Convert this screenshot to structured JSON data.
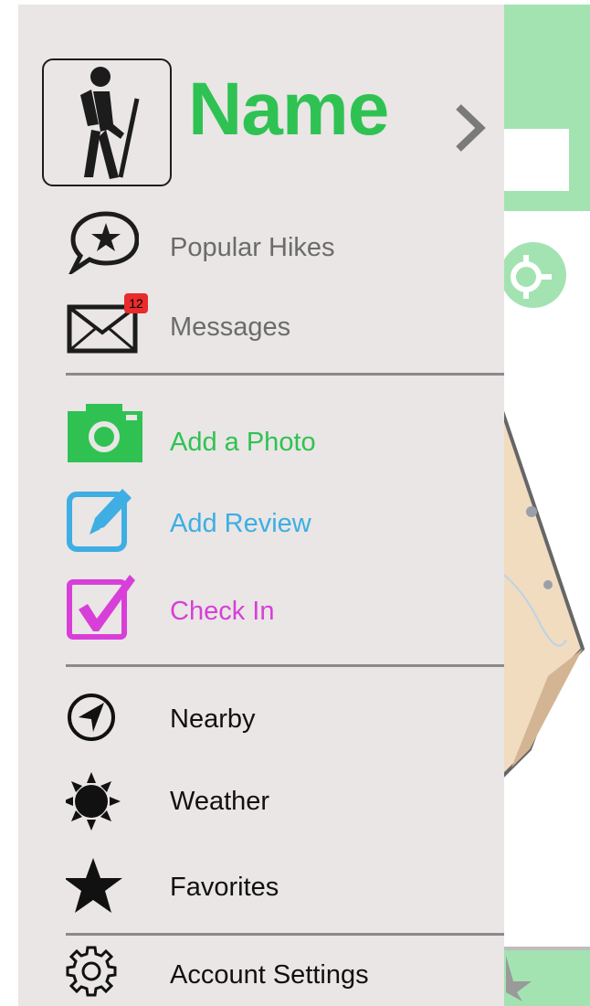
{
  "profile": {
    "name": "Name",
    "name_color": "#2fc253",
    "avatar_icon": "hiker-icon",
    "chevron_icon": "chevron-right-icon"
  },
  "menu": {
    "popular_hikes": {
      "label": "Popular Hikes",
      "icon": "speech-bubble-star-icon",
      "color": "#6b6b6b"
    },
    "messages": {
      "label": "Messages",
      "icon": "envelope-icon",
      "badge": "12",
      "badge_color": "#e82b2b",
      "color": "#6b6b6b"
    },
    "add_photo": {
      "label": "Add a Photo",
      "icon": "camera-icon",
      "color": "#2fc253"
    },
    "add_review": {
      "label": "Add Review",
      "icon": "edit-icon",
      "color": "#3eaee3"
    },
    "check_in": {
      "label": "Check In",
      "icon": "checkbox-icon",
      "color": "#d83fd9"
    },
    "nearby": {
      "label": "Nearby",
      "icon": "navigation-arrow-icon",
      "color": "#111111"
    },
    "weather": {
      "label": "Weather",
      "icon": "sun-icon",
      "color": "#111111"
    },
    "favorites": {
      "label": "Favorites",
      "icon": "star-icon",
      "color": "#111111"
    },
    "account_settings": {
      "label": "Account Settings",
      "icon": "gear-icon",
      "color": "#111111"
    }
  },
  "colors": {
    "drawer_background": "#e9e6e5",
    "app_accent": "#a3e3b1",
    "divider": "#8a8a8a"
  }
}
